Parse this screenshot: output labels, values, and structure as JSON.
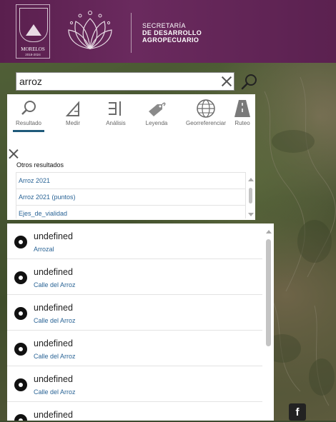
{
  "header": {
    "crest_name": "MORELOS",
    "crest_years": "2018-2024",
    "secretaria_line1": "SECRETARÍA",
    "secretaria_line2": "DE DESARROLLO",
    "secretaria_line3": "AGROPECUARIO",
    "brand_color": "#5a1f4e"
  },
  "search": {
    "value": "arroz",
    "clear_icon": "close-icon",
    "search_icon": "search-icon"
  },
  "tools": [
    {
      "label": "Resultado",
      "icon": "search-icon",
      "active": true
    },
    {
      "label": "Medir",
      "icon": "ruler-icon"
    },
    {
      "label": "Análisis",
      "icon": "analysis-icon"
    },
    {
      "label": "Leyenda",
      "icon": "tag-icon"
    },
    {
      "label": "Georreferenciar",
      "icon": "globe-icon"
    },
    {
      "label": "Ruteo",
      "icon": "road-icon"
    }
  ],
  "other_results": {
    "title": "Otros resultados",
    "items": [
      "Arroz 2021",
      "Arroz 2021 (puntos)",
      "Ejes_de_vialidad"
    ]
  },
  "results": [
    {
      "title": "undefined",
      "subtitle": "Arrozal"
    },
    {
      "title": "undefined",
      "subtitle": "Calle del Arroz"
    },
    {
      "title": "undefined",
      "subtitle": "Calle del Arroz"
    },
    {
      "title": "undefined",
      "subtitle": "Calle del Arroz"
    },
    {
      "title": "undefined",
      "subtitle": "Calle del Arroz"
    },
    {
      "title": "undefined",
      "subtitle": ""
    }
  ],
  "social": {
    "facebook_glyph": "f"
  },
  "colors": {
    "link": "#2a6496",
    "active_tab": "#1f5a7a"
  }
}
